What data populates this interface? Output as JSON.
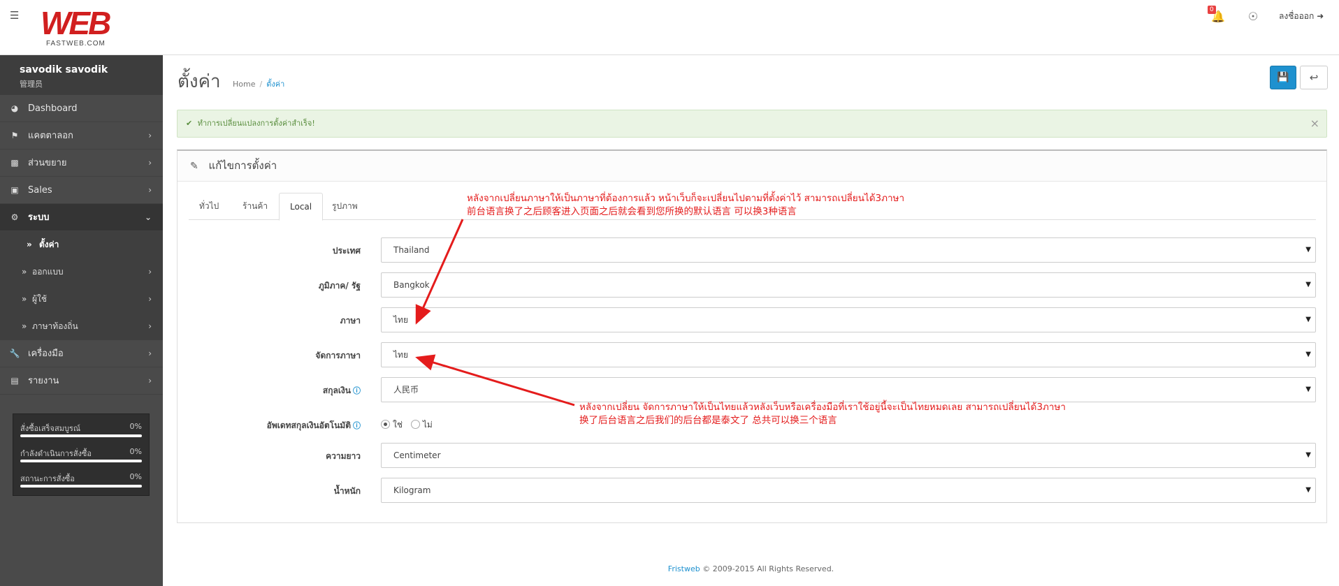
{
  "header": {
    "logo_text": "WEB",
    "logo_tagline": "FASTWEB.COM",
    "notification_count": "0",
    "logout_label": "ลงชื่อออก"
  },
  "sidebar": {
    "profile": {
      "name": "savodik savodik",
      "role": "管理员"
    },
    "items": [
      {
        "label": "Dashboard",
        "icon": "dashboard-icon"
      },
      {
        "label": "แคตตาลอก",
        "icon": "tags-icon"
      },
      {
        "label": "ส่วนขยาย",
        "icon": "puzzle-icon"
      },
      {
        "label": "Sales",
        "icon": "cart-icon"
      },
      {
        "label": "ระบบ",
        "icon": "gear-icon"
      }
    ],
    "sub_items": [
      {
        "label": "ตั้งค่า"
      },
      {
        "label": "ออกแบบ"
      },
      {
        "label": "ผู้ใช้"
      },
      {
        "label": "ภาษาท้องถิ่น"
      }
    ],
    "items_after": [
      {
        "label": "เครื่องมือ",
        "icon": "wrench-icon"
      },
      {
        "label": "รายงาน",
        "icon": "bar-chart-icon"
      }
    ],
    "stats": [
      {
        "label": "สั่งซื้อเสร็จสมบูรณ์",
        "value": "0%",
        "progress": 0
      },
      {
        "label": "กำลังดำเนินการสั่งซื้อ",
        "value": "0%",
        "progress": 0
      },
      {
        "label": "สถานะการสั่งซื้อ",
        "value": "0%",
        "progress": 0
      }
    ]
  },
  "page": {
    "title": "ตั้งค่า",
    "breadcrumb": [
      "Home",
      "ตั้งค่า"
    ],
    "alert": "ทำการเปลี่ยนแปลงการตั้งค่าสำเร็จ!",
    "panel_title": "แก้ไขการตั้งค่า",
    "tabs": [
      "ทั่วไป",
      "ร้านค้า",
      "Local",
      "รูปภาพ"
    ],
    "active_tab": "Local"
  },
  "form": {
    "country": {
      "label": "ประเทศ",
      "value": "Thailand"
    },
    "region": {
      "label": "ภูมิภาค/ รัฐ",
      "value": "Bangkok"
    },
    "language": {
      "label": "ภาษา",
      "value": "ไทย"
    },
    "admin_language": {
      "label": "จัดการภาษา",
      "value": "ไทย"
    },
    "currency": {
      "label": "สกุลเงิน",
      "value": "人民币"
    },
    "auto_update": {
      "label": "อัพเดทสกุลเงินอัตโนมัติ",
      "yes": "ใช่",
      "no": "ไม่",
      "selected": "yes"
    },
    "length": {
      "label": "ความยาว",
      "value": "Centimeter"
    },
    "weight": {
      "label": "น้ำหนัก",
      "value": "Kilogram"
    }
  },
  "annotations": {
    "top_line1": "หลังจากเปลี่ยนภาษาให้เป็นภาษาที่ต้องการแล้ว หน้าเว็บก็จะเปลี่ยนไปตามที่ตั้งค่าไว้ สามารถเปลี่ยนได้3ภาษา",
    "top_line2": "前台语言换了之后顾客进入页面之后就会看到您所换的默认语言 可以换3种语言",
    "bottom_line1": "หลังจากเปลี่ยน จัดการภาษาให้เป็นไทยแล้วหลังเว็บหรือเครื่องมือที่เราใช้อยู่นี้จะเป็นไทยหมดเลย สามารถเปลี่ยนได้3ภาษา",
    "bottom_line2": "换了后台语言之后我们的后台都是泰文了 总共可以换三个语言",
    "color": "#e41c1c"
  },
  "footer": {
    "brand": "Fristweb",
    "text": "© 2009-2015 All Rights Reserved."
  }
}
